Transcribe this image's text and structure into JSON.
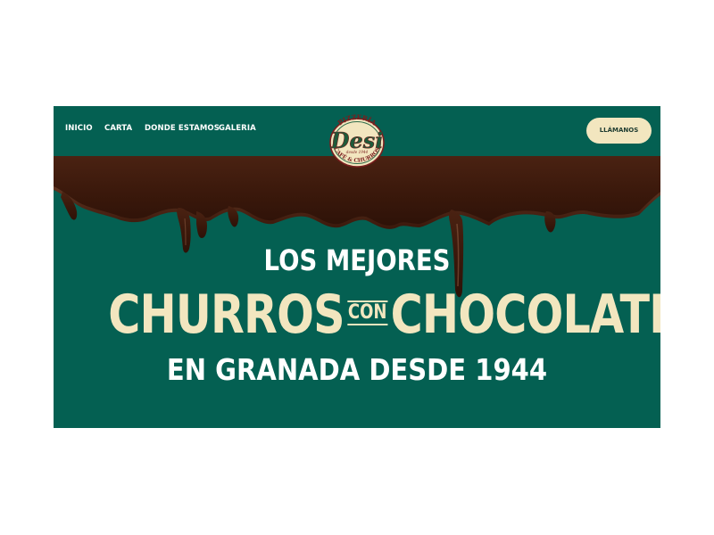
{
  "nav": {
    "items": [
      {
        "label": "INICIO"
      },
      {
        "label": "CARTA"
      },
      {
        "label": "DONDE ESTAMOS"
      },
      {
        "label": "GALERIA"
      }
    ],
    "call_button": "LLÁMANOS"
  },
  "logo": {
    "top_text": "PIZZERÍA",
    "brand": "Desi",
    "since": "desde 1944",
    "bottom_text": "CAFÉ & CHURROS"
  },
  "hero": {
    "line1": "LOS MEJORES",
    "line2_left": "CHURROS",
    "line2_mid": "CON",
    "line2_right": "CHOCOLATE",
    "line3": "EN GRANADA DESDE 1944"
  },
  "colors": {
    "background_green": "#046052",
    "cream": "#f2e6bf",
    "chocolate": "#3d1a0e"
  }
}
